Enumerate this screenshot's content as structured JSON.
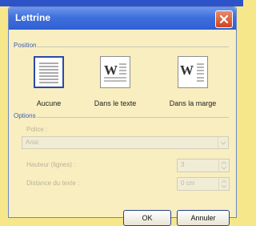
{
  "dialog": {
    "title": "Lettrine",
    "close_icon": "close-icon"
  },
  "position": {
    "section_label": "Position",
    "options": [
      {
        "label": "Aucune",
        "icon": "no-dropcap-icon",
        "selected": true
      },
      {
        "label": "Dans le texte",
        "icon": "dropped-icon",
        "selected": false
      },
      {
        "label": "Dans la marge",
        "icon": "in-margin-icon",
        "selected": false
      }
    ]
  },
  "options": {
    "section_label": "Options",
    "font_label": "Police :",
    "font_value": "Arial",
    "lines_label": "Hauteur (lignes) :",
    "lines_value": "3",
    "distance_label": "Distance du texte :",
    "distance_value": "0 cm"
  },
  "buttons": {
    "ok": "OK",
    "cancel": "Annuler"
  },
  "colors": {
    "titlebar": "#2f5fd4",
    "background": "#f6e88a",
    "dialog_face": "#f8eec0",
    "section_text": "#3b5fb8"
  }
}
